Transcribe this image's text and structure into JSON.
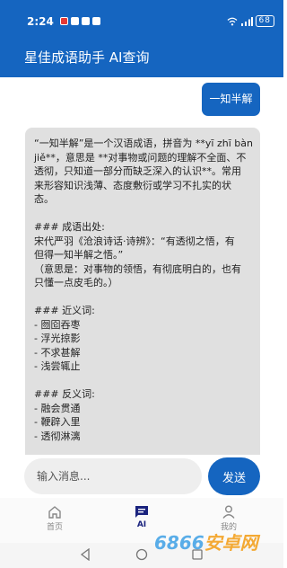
{
  "status_bar": {
    "time": "2:24",
    "signal_text": "⊠ ∦ ⊓0 ≋ ⁵ₒ ıll",
    "battery": "68"
  },
  "app_bar": {
    "title": "星佳成语助手 AI查询"
  },
  "chat": {
    "user_message": "一知半解",
    "bot_lines": [
      "“一知半解”是一个汉语成语，拼音为 **yī zhī bàn",
      "jiě**，意思是 **对事物或问题的理解不全面、不",
      "透彻，只知道一部分而缺乏深入的认识**。常用",
      "来形容知识浅薄、态度敷衍或学习不扎实的状",
      "态。",
      "",
      "### 成语出处:",
      "宋代严羽《沧浪诗话·诗辨》：“有透彻之悟，有",
      "但得一知半解之悟。”",
      "（意思是：对事物的领悟，有彻底明白的，也有",
      "只懂一点皮毛的。）",
      "",
      "### 近义词:",
      "- 囫囵吞枣",
      "- 浮光掠影",
      "- 不求甚解",
      "- 浅尝辄止",
      "",
      "### 反义词:",
      "- 融会贯通",
      "- 鞭辟入里",
      "- 透彻淋漓"
    ]
  },
  "composer": {
    "placeholder": "输入消息...",
    "send_label": "发送"
  },
  "bottom_nav": {
    "items": [
      {
        "label": "首页",
        "icon": "home-icon",
        "active": false
      },
      {
        "label": "AI",
        "icon": "chat-icon",
        "active": true
      },
      {
        "label": "我的",
        "icon": "person-icon",
        "active": false
      }
    ]
  },
  "watermark": {
    "digits": "6866",
    "suffix": "安卓网"
  },
  "colors": {
    "primary": "#1565c0",
    "bubble_gray": "#e0e0e0",
    "nav_active": "#1a237e"
  }
}
